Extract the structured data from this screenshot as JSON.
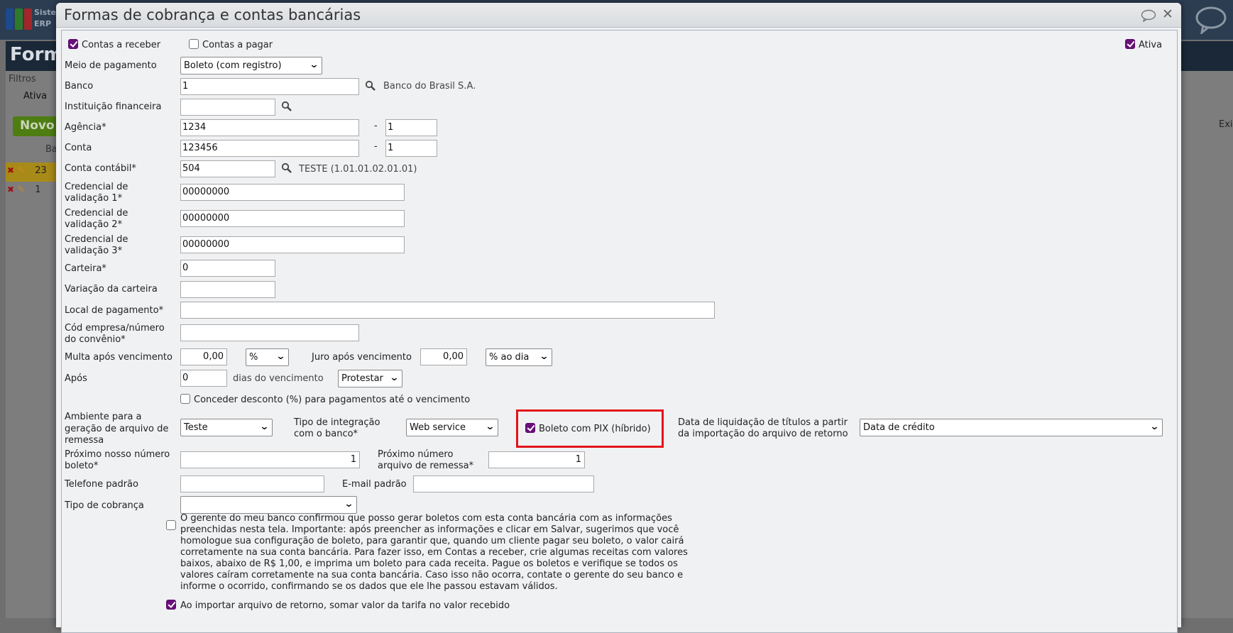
{
  "background": {
    "brand_line1": "Sister",
    "brand_line2": "ERP",
    "page_header": "Form",
    "filters_label": "Filtros",
    "filter_active_label": "Ativa",
    "new_button": "Novo",
    "table_header": "Ba",
    "rows": [
      "23",
      "1"
    ],
    "right_text": "Exi"
  },
  "modal": {
    "title": "Formas de cobrança e contas bancárias",
    "contas_receber": {
      "label": "Contas a receber",
      "checked": true
    },
    "contas_pagar": {
      "label": "Contas a pagar",
      "checked": false
    },
    "ativa": {
      "label": "Ativa",
      "checked": true
    },
    "meio_pagamento": {
      "label": "Meio de pagamento",
      "value": "Boleto (com registro)"
    },
    "banco": {
      "label": "Banco",
      "value": "1",
      "name": "Banco do Brasil S.A."
    },
    "instituicao": {
      "label": "Instituição financeira",
      "value": ""
    },
    "agencia": {
      "label": "Agência*",
      "value": "1234",
      "digit": "1"
    },
    "conta": {
      "label": "Conta",
      "value": "123456",
      "digit": "1"
    },
    "separator": "-",
    "conta_contabil": {
      "label": "Conta contábil*",
      "value": "504",
      "name": "TESTE (1.01.01.02.01.01)"
    },
    "cred1": {
      "label1": "Credencial de",
      "label2": "validação 1*",
      "value": "00000000"
    },
    "cred2": {
      "label1": "Credencial de",
      "label2": "validação 2*",
      "value": "00000000"
    },
    "cred3": {
      "label1": "Credencial de",
      "label2": "validação 3*",
      "value": "00000000"
    },
    "carteira": {
      "label": "Carteira*",
      "value": "0"
    },
    "variacao": {
      "label": "Variação da carteira",
      "value": ""
    },
    "local_pagamento": {
      "label": "Local de pagamento*",
      "value": ""
    },
    "cod_empresa": {
      "label1": "Cód empresa/número",
      "label2": "do convênio*",
      "value": ""
    },
    "multa": {
      "label": "Multa após vencimento",
      "value": "0,00",
      "unit": "%"
    },
    "juro": {
      "label": "Juro após vencimento",
      "value": "0,00",
      "unit": "% ao dia"
    },
    "apos": {
      "label": "Após",
      "value": "0",
      "suffix": "dias do vencimento",
      "action": "Protestar"
    },
    "desconto": {
      "label": "Conceder desconto (%) para pagamentos até o vencimento",
      "checked": false
    },
    "ambiente": {
      "label1": "Ambiente para a",
      "label2": "geração de arquivo de",
      "label3": "remessa",
      "value": "Teste"
    },
    "integracao": {
      "label1": "Tipo de integração",
      "label2": "com o banco*",
      "value": "Web service"
    },
    "pix": {
      "label": "Boleto com PIX (híbrido)",
      "checked": true
    },
    "liquidacao": {
      "label1": "Data de liquidação de títulos a partir",
      "label2": "da importação do arquivo de retorno",
      "value": "Data de crédito"
    },
    "nosso_numero": {
      "label1": "Próximo nosso número",
      "label2": "boleto*",
      "value": "1"
    },
    "num_remessa": {
      "label1": "Próximo número",
      "label2": "arquivo de remessa*",
      "value": "1"
    },
    "telefone": {
      "label": "Telefone padrão",
      "value": ""
    },
    "email": {
      "label": "E-mail padrão",
      "value": ""
    },
    "tipo_cobranca": {
      "label": "Tipo de cobrança",
      "value": ""
    },
    "confirmacao": {
      "checked": false,
      "text": "O gerente do meu banco confirmou que posso gerar boletos com esta conta bancária com as informações preenchidas nesta tela. Importante: após preencher as informações e clicar em Salvar, sugerimos que você homologue sua configuração de boleto, para garantir que, quando um cliente pagar seu boleto, o valor cairá corretamente na sua conta bancária. Para fazer isso, em Contas a receber, crie algumas receitas com valores baixos, abaixo de R$ 1,00, e imprima um boleto para cada receita. Pague os boletos e verifique se todos os valores caíram corretamente na sua conta bancária. Caso isso não ocorra, contate o gerente do seu banco e informe o ocorrido, confirmando se os dados que ele lhe passou estavam válidos."
    },
    "tarifa": {
      "label": "Ao importar arquivo de retorno, somar valor da tarifa no valor recebido",
      "checked": true
    }
  },
  "colors": {
    "checkbox": "#6a0f7a",
    "highlight": "#e3141b",
    "accent_green": "#4e7d12"
  }
}
